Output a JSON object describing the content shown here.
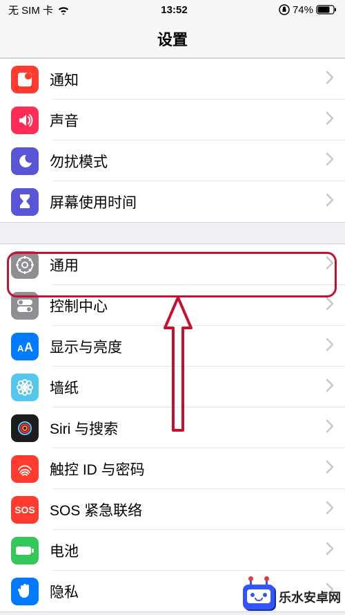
{
  "status": {
    "carrier": "无 SIM 卡",
    "time": "13:52",
    "battery_pct": "74%"
  },
  "header": {
    "title": "设置"
  },
  "groups": [
    {
      "rows": [
        {
          "key": "notifications",
          "label": "通知",
          "icon": "notifications-icon",
          "iconClass": "bg-notif"
        },
        {
          "key": "sounds",
          "label": "声音",
          "icon": "sounds-icon",
          "iconClass": "bg-sound"
        },
        {
          "key": "dnd",
          "label": "勿扰模式",
          "icon": "moon-icon",
          "iconClass": "bg-dnd"
        },
        {
          "key": "screentime",
          "label": "屏幕使用时间",
          "icon": "hourglass-icon",
          "iconClass": "bg-screentime"
        }
      ]
    },
    {
      "rows": [
        {
          "key": "general",
          "label": "通用",
          "icon": "gear-icon",
          "iconClass": "bg-general",
          "highlighted": true
        },
        {
          "key": "controlcenter",
          "label": "控制中心",
          "icon": "toggles-icon",
          "iconClass": "bg-control"
        },
        {
          "key": "display",
          "label": "显示与亮度",
          "icon": "text-size-icon",
          "iconClass": "bg-display"
        },
        {
          "key": "wallpaper",
          "label": "墙纸",
          "icon": "flower-icon",
          "iconClass": "bg-wallpaper"
        },
        {
          "key": "siri",
          "label": "Siri 与搜索",
          "icon": "siri-icon",
          "iconClass": "bg-siri"
        },
        {
          "key": "touchid",
          "label": "触控 ID 与密码",
          "icon": "fingerprint-icon",
          "iconClass": "bg-touchid"
        },
        {
          "key": "sos",
          "label": "SOS 紧急联络",
          "icon": "sos-icon",
          "iconClass": "bg-sos",
          "iconText": "SOS"
        },
        {
          "key": "battery",
          "label": "电池",
          "icon": "battery-icon",
          "iconClass": "bg-battery"
        },
        {
          "key": "privacy",
          "label": "隐私",
          "icon": "hand-icon",
          "iconClass": "bg-privacy"
        }
      ]
    }
  ],
  "annotation": {
    "highlight_color": "#c8102e",
    "arrow_color": "#c8102e"
  },
  "watermark": {
    "text": "乐水安卓网"
  }
}
